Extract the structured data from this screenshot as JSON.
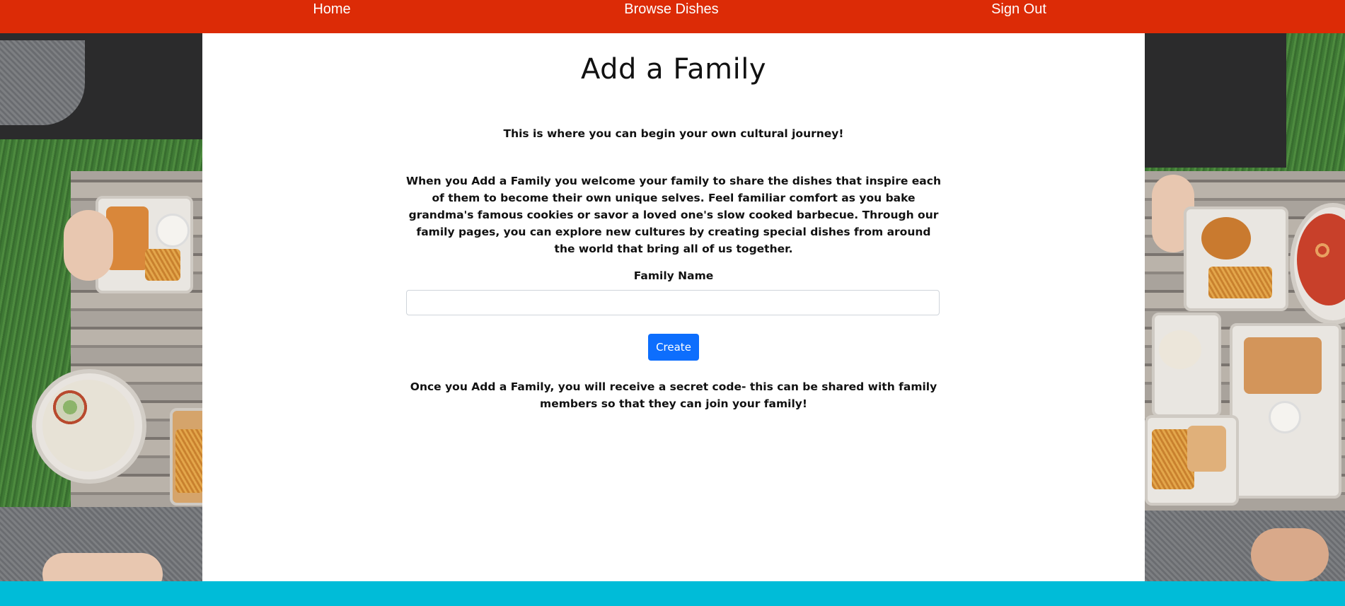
{
  "nav": {
    "home": "Home",
    "browse_dishes": "Browse Dishes",
    "sign_out": "Sign Out"
  },
  "page": {
    "title": "Add a Family",
    "intro": "This is where you can begin your own cultural journey!",
    "description": "When you Add a Family you welcome your family to share the dishes that inspire each of them to become their own unique selves. Feel familiar comfort as you bake grandma's famous cookies or savor a loved one's slow cooked barbecue. Through our family pages, you can explore new cultures by creating special dishes from around the world that bring all of us together.",
    "family_name_label": "Family Name",
    "family_name_value": "",
    "family_name_placeholder": "",
    "create_button": "Create",
    "note": "Once you Add a Family, you will receive a secret code- this can be shared with family members so that they can join your family!"
  },
  "colors": {
    "nav_bg": "#dc2b06",
    "footer_bg": "#00bcd8",
    "button_bg": "#0d6efd",
    "content_bg": "#ffffff"
  }
}
